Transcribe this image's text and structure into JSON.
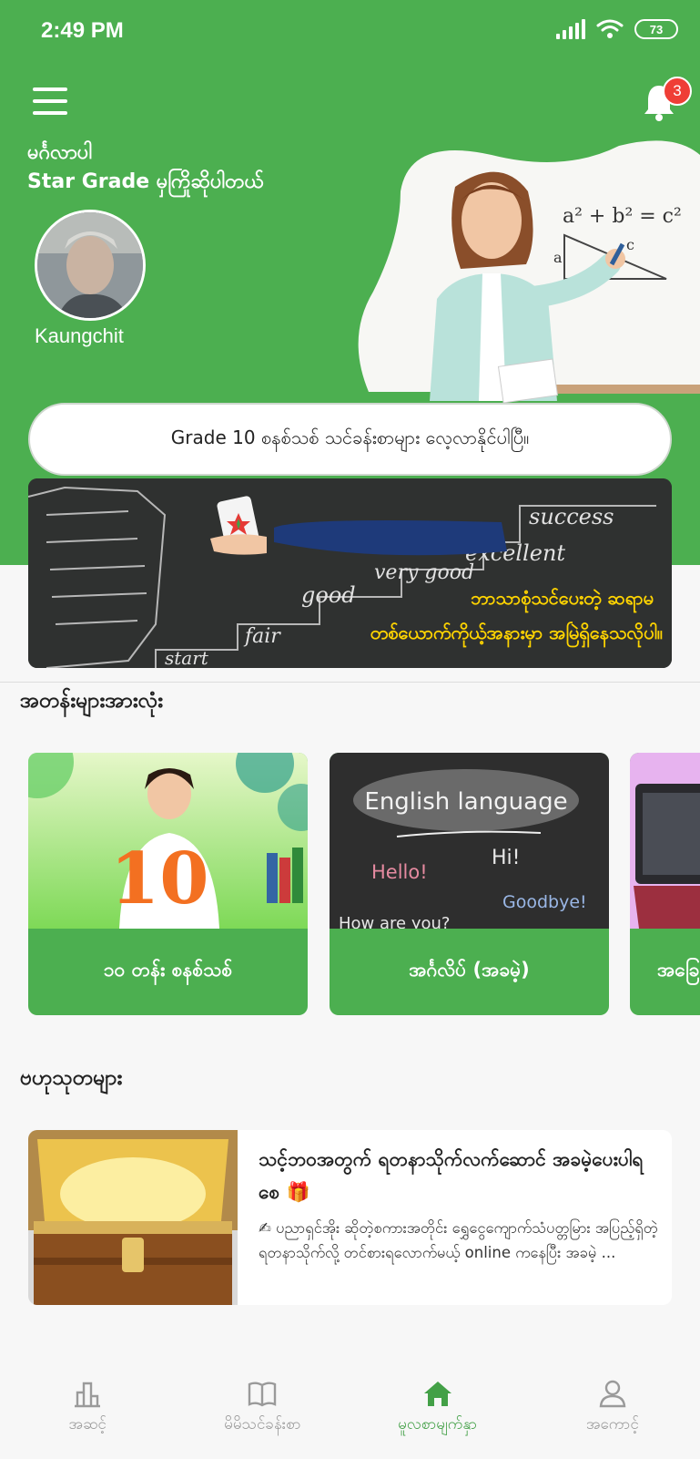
{
  "status_bar": {
    "time": "2:49 PM",
    "battery": "73"
  },
  "header": {
    "notification_count": "3",
    "greeting_line1": "မင်္ဂလာပါ",
    "greeting_line2": "Star Grade မှကြိုဆိုပါတယ်",
    "username": "Kaungchit",
    "formula": "a² + b² = c²"
  },
  "announcement": "Grade 10 စနစ်သစ် သင်ခန်းစာများ လေ့လာနိုင်ပါပြီ။",
  "promo_banner": {
    "stairs": [
      "start",
      "fair",
      "good",
      "very good",
      "excellent",
      "success"
    ],
    "line1": "ဘာသာစုံသင်ပေးတဲ့ ဆရာမ",
    "line2": "တစ်ယောက်ကိုယ့်အနားမှာ အမြဲရှိနေသလိုပါ။"
  },
  "courses_section": {
    "title": "အတန်းများအားလုံး",
    "items": [
      {
        "label": "၁၀ တန်း စနစ်သစ်",
        "image_text": "10"
      },
      {
        "label": "အင်္ဂလိပ် (အခမဲ့)",
        "image_text": "English language",
        "chalk": [
          "Hi!",
          "Hello!",
          "Goodbye!",
          "How are you?"
        ]
      },
      {
        "label": "အခြေ"
      }
    ]
  },
  "articles_section": {
    "title": "ဗဟုသုတများ",
    "items": [
      {
        "title": "သင့်ဘဝအတွက် ရတနာသိုက်လက်ဆောင် အခမဲ့ပေးပါရစေ 🎁",
        "excerpt": "✍ ပညာရှင်အိုး ဆိုတဲ့စကားအတိုင်း ရွှေငွေကျောက်သံပတ္တမြား အပြည့်ရှိတဲ့ ရတနာသိုက်လို့ တင်စားရလောက်မယ့် online ကနေပြီး အခမဲ့ ..."
      }
    ]
  },
  "bottom_nav": [
    {
      "label": "အဆင့်",
      "icon": "ranking-icon"
    },
    {
      "label": "မိမိသင်ခန်းစာ",
      "icon": "book-icon"
    },
    {
      "label": "မူလစာမျက်နှာ",
      "icon": "home-icon",
      "active": true
    },
    {
      "label": "အကောင့်",
      "icon": "account-icon"
    }
  ],
  "colors": {
    "primary": "#4caf50",
    "badge": "#ef3e36",
    "promo_text": "#ffd400"
  }
}
